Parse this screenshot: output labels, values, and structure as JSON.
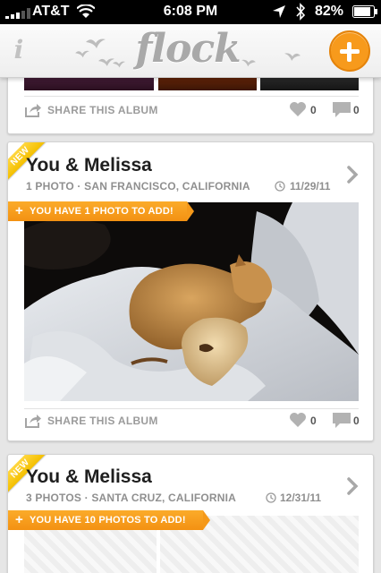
{
  "status_bar": {
    "carrier": "AT&T",
    "time": "6:08 PM",
    "battery": "82%",
    "icons": [
      "signal-icon",
      "wifi-icon",
      "location-icon",
      "bluetooth-icon",
      "battery-icon"
    ]
  },
  "nav": {
    "info_label": "i",
    "logo_text": "flock",
    "add_icon": "plus-icon",
    "accent_color": "#f79a1c"
  },
  "albums": [
    {
      "share_label": "SHARE THIS ALBUM",
      "likes": "0",
      "comments": "0"
    },
    {
      "badge": "NEW",
      "title": "You & Melissa",
      "meta": "1 PHOTO · SAN FRANCISCO, CALIFORNIA",
      "date": "11/29/11",
      "add_banner": "YOU HAVE 1 PHOTO TO ADD!",
      "share_label": "SHARE THIS ALBUM",
      "likes": "0",
      "comments": "0"
    },
    {
      "badge": "NEW",
      "title": "You & Melissa",
      "meta": "3 PHOTOS · SANTA CRUZ, CALIFORNIA",
      "date": "12/31/11",
      "add_banner": "YOU HAVE 10 PHOTOS TO ADD!"
    }
  ],
  "colors": {
    "orange": "#f79a1c",
    "new_badge": "#f4c000",
    "text_gray": "#8f8f8f"
  }
}
